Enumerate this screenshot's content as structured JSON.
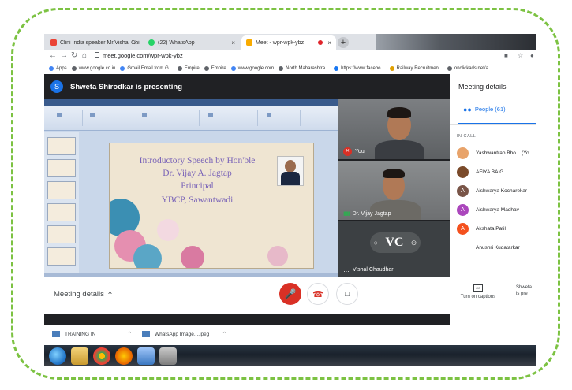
{
  "browser": {
    "tabs": [
      {
        "label": "Clini India speaker Mr.Vishal Chi",
        "close": "×",
        "color": "#ea4335"
      },
      {
        "label": "(22) WhatsApp",
        "close": "×",
        "color": "#25d366"
      },
      {
        "label": "Meet - wpr-wpk-ybz",
        "close": "×",
        "color": "#f9ab00"
      }
    ],
    "new_tab": "+",
    "url": "meet.google.com/wpr-wpk-ybz",
    "bookmarks": [
      {
        "label": "Apps",
        "color": "#4285f4"
      },
      {
        "label": "www.google.co.in",
        "color": "#5f6368"
      },
      {
        "label": "Gmail Email from G...",
        "color": "#4285f4"
      },
      {
        "label": "Empire",
        "color": "#5f6368"
      },
      {
        "label": "Empire",
        "color": "#5f6368"
      },
      {
        "label": "www.google.com",
        "color": "#4285f4"
      },
      {
        "label": "North Maharashtra...",
        "color": "#5f6368"
      },
      {
        "label": "https://www.facebo...",
        "color": "#1877f2"
      },
      {
        "label": "Railway Recruitmen...",
        "color": "#e0a000"
      },
      {
        "label": "onclickads.net/a",
        "color": "#5f6368"
      }
    ]
  },
  "meet": {
    "presenter_initial": "S",
    "presenting_text": "Shweta Shirodkar is presenting",
    "slide": {
      "line1": "Introductory Speech by Hon'ble",
      "line2": "Dr. Vijay A. Jagtap",
      "line3": "Principal",
      "line4": "YBCP, Sawantwadi"
    },
    "tiles": [
      {
        "name": "You"
      },
      {
        "name": "Dr. Vijay Jagtap"
      },
      {
        "name": "Vishal Chaudhari",
        "logo": "VC"
      }
    ],
    "side_panel": {
      "title": "Meeting details",
      "people_tab": "People (61)",
      "section": "IN CALL",
      "participants": [
        {
          "name": "Yashwantrao Bho... (Yo",
          "initial": "",
          "color": "#e8a36a"
        },
        {
          "name": "AFIYA BAIG",
          "initial": "",
          "color": "#7a4a2a"
        },
        {
          "name": "Aishwarya Kocharekar",
          "initial": "A",
          "color": "#795548"
        },
        {
          "name": "Aishwarya Madhav",
          "initial": "A",
          "color": "#ab47bc"
        },
        {
          "name": "Akshata Patil",
          "initial": "A",
          "color": "#f4511e"
        },
        {
          "name": "Anushri Kudatarkar",
          "initial": "",
          "color": "#ffffff"
        }
      ]
    },
    "bottom": {
      "meeting_details": "Meeting details",
      "chevron": "^",
      "captions": "Turn on captions",
      "cc": "CC",
      "cut_line1": "Shweta",
      "cut_line2": "is pre"
    }
  },
  "downloads": [
    {
      "label": "TRAINING IN"
    },
    {
      "label": "WhatsApp Image....jpeg"
    }
  ]
}
